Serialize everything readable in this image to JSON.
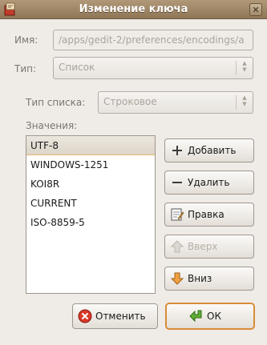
{
  "window": {
    "title": "Изменение ключа"
  },
  "form": {
    "name_label": "Имя:",
    "name_value": "/apps/gedit-2/preferences/encodings/a",
    "type_label": "Тип:",
    "type_value": "Список",
    "list_type_label": "Тип списка:",
    "list_type_value": "Строковое",
    "values_label": "Значения:"
  },
  "values": [
    "UTF-8",
    "WINDOWS-1251",
    "KOI8R",
    "CURRENT",
    "ISO-8859-5"
  ],
  "selected_index": 0,
  "buttons": {
    "add": "Добавить",
    "remove": "Удалить",
    "edit": "Правка",
    "up": "Вверх",
    "down": "Вниз",
    "cancel": "Отменить",
    "ok": "ОК"
  },
  "colors": {
    "accent": "#d88c3a",
    "titlebar": "#9e8564"
  }
}
